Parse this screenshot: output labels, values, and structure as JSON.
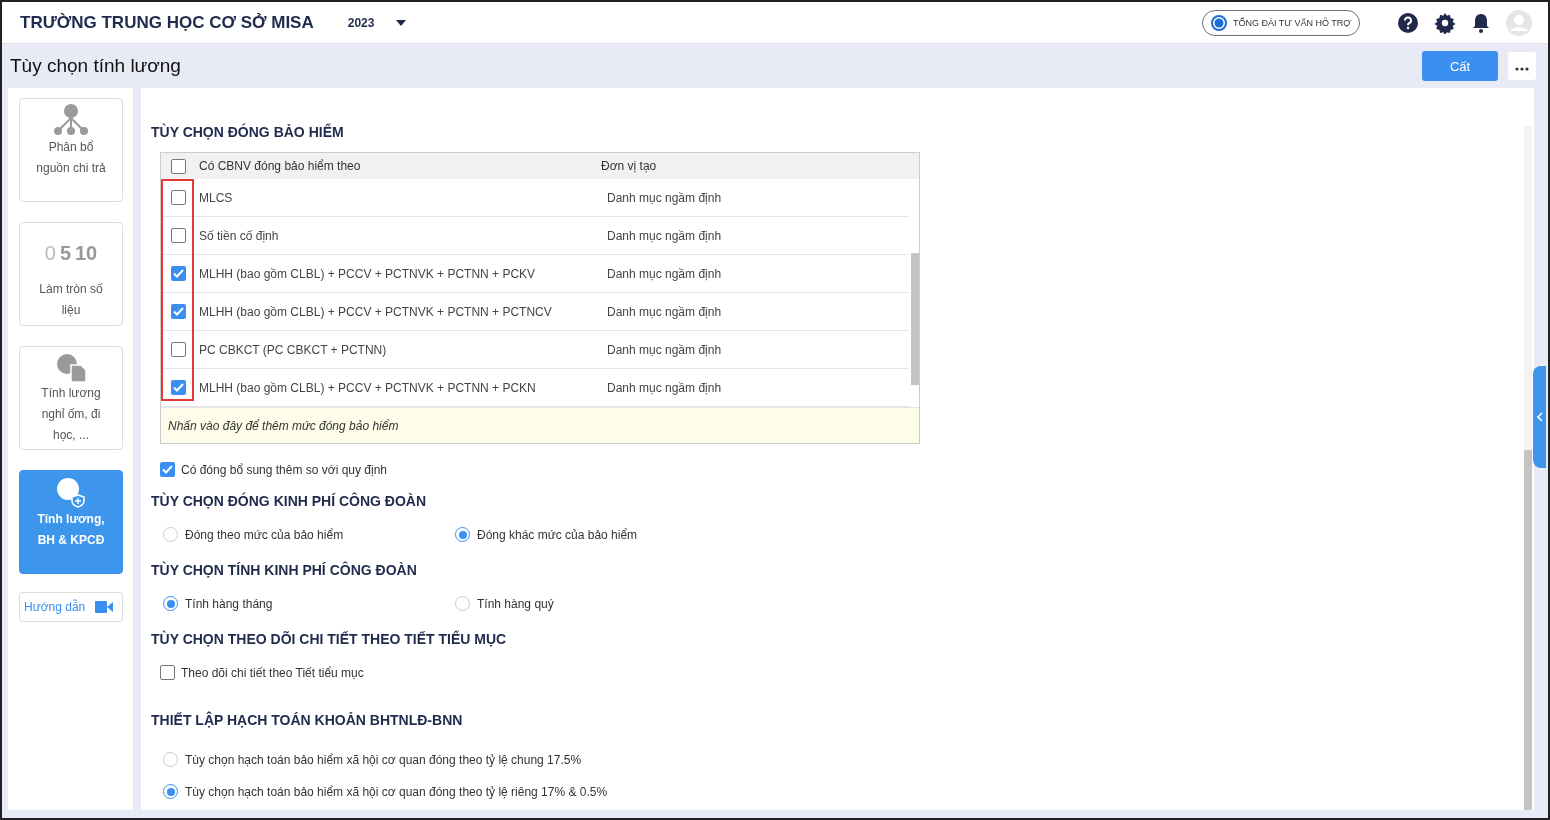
{
  "header": {
    "school": "TRƯỜNG TRUNG HỌC CƠ SỞ MISA",
    "year": "2023",
    "hotline": "TỔNG ĐÀI TƯ VẤN HỖ TRỢ"
  },
  "page": {
    "title": "Tùy chọn tính lương",
    "save": "Cất"
  },
  "sidebar": {
    "items": [
      {
        "kind": "allocation",
        "label": "Phân bổ nguồn chi trả",
        "selected": false
      },
      {
        "kind": "rounding",
        "digits": [
          "0",
          "5",
          "10"
        ],
        "label": "Làm tròn số liệu",
        "selected": false
      },
      {
        "kind": "leave",
        "label": "Tính lương nghỉ ốm, đi học, ...",
        "selected": false
      },
      {
        "kind": "salary",
        "label": "Tính lương, BH & KPCĐ",
        "selected": true
      }
    ],
    "guide": "Hướng dẫn"
  },
  "insurance": {
    "title": "TÙY CHỌN ĐÓNG BẢO HIỂM",
    "columns": [
      "Có CBNV đóng bảo hiểm theo",
      "Đơn vị tạo"
    ],
    "all_checked": false,
    "rows": [
      {
        "name": "MLCS",
        "creator": "Danh mục ngầm định",
        "checked": false
      },
      {
        "name": "Số tiền cố định",
        "creator": "Danh mục ngầm định",
        "checked": false
      },
      {
        "name": "MLHH (bao gồm CLBL) + PCCV + PCTNVK + PCTNN + PCKV",
        "creator": "Danh mục ngầm định",
        "checked": true
      },
      {
        "name": "MLHH (bao gồm CLBL) + PCCV + PCTNVK + PCTNN + PCTNCV",
        "creator": "Danh mục ngầm định",
        "checked": true
      },
      {
        "name": "PC CBKCT (PC CBKCT + PCTNN)",
        "creator": "Danh mục ngầm định",
        "checked": false
      },
      {
        "name": "MLHH (bao gồm CLBL) + PCCV + PCTNVK + PCTNN + PCKN",
        "creator": "Danh mục ngầm định",
        "checked": true
      }
    ],
    "add_hint": "Nhấn vào đây để thêm mức đóng bảo hiểm",
    "extra": {
      "label": "Có đóng bổ sung thêm so với quy định",
      "checked": true
    }
  },
  "sections": [
    {
      "kind": "radio_row",
      "title": "TÙY CHỌN ĐÓNG KINH PHÍ CÔNG ĐOÀN",
      "options": [
        {
          "label": "Đóng theo mức của bảo hiểm",
          "selected": false
        },
        {
          "label": "Đóng khác mức của bảo hiểm",
          "selected": true
        }
      ]
    },
    {
      "kind": "radio_row",
      "title": "TÙY CHỌN TÍNH KINH PHÍ CÔNG ĐOÀN",
      "options": [
        {
          "label": "Tính hàng tháng",
          "selected": true
        },
        {
          "label": "Tính hàng quý",
          "selected": false
        }
      ]
    },
    {
      "kind": "checkbox",
      "title": "TÙY CHỌN THEO DÕI CHI TIẾT THEO TIẾT TIỂU MỤC",
      "options": [
        {
          "label": "Theo dõi chi tiết theo Tiết tiểu mục",
          "checked": false
        }
      ]
    },
    {
      "kind": "radio_column",
      "title": "THIẾT LẬP HẠCH TOÁN KHOẢN BHTNLĐ-BNN",
      "options": [
        {
          "label": "Tùy chọn hạch toán bảo hiểm xã hội cơ quan đóng theo tỷ lệ chung 17.5%",
          "selected": false
        },
        {
          "label": "Tùy chọn hạch toán bảo hiểm xã hội cơ quan đóng theo tỷ lệ riêng 17% & 0.5%",
          "selected": true
        }
      ]
    }
  ]
}
